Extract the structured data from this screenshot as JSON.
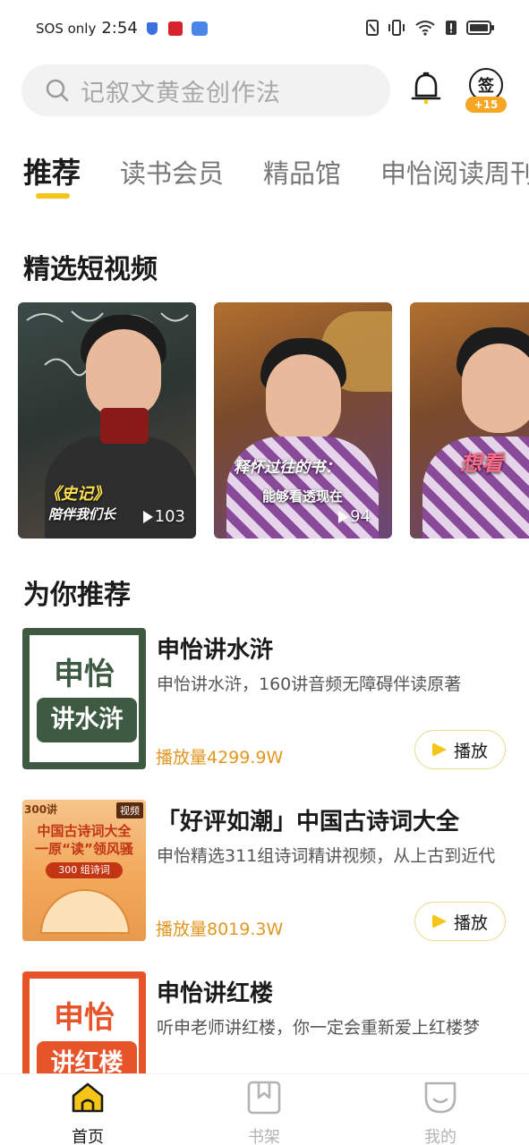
{
  "status_bar": {
    "carrier": "SOS only",
    "time": "2:54",
    "signal_label": "6"
  },
  "search": {
    "placeholder": "记叙文黄金创作法"
  },
  "header": {
    "checkin_label": "签",
    "checkin_badge": "+15"
  },
  "tabs": [
    {
      "label": "推荐",
      "active": true
    },
    {
      "label": "读书会员",
      "active": false
    },
    {
      "label": "精品馆",
      "active": false
    },
    {
      "label": "申怡阅读周刊",
      "active": false
    }
  ],
  "short_videos": {
    "title": "精选短视频",
    "items": [
      {
        "overlay_line1": "《史记》",
        "overlay_line2": "陪伴我们长",
        "plays": "103"
      },
      {
        "overlay_line1": "释怀过往的书：",
        "overlay_line2": "能够看透现在",
        "plays": "94"
      },
      {
        "overlay_line1": "想看",
        "overlay_line2": "",
        "plays": ""
      }
    ]
  },
  "recommend": {
    "title": "为你推荐",
    "items": [
      {
        "title": "申怡讲水浒",
        "desc": "申怡讲水浒，160讲音频无障碍伴读原著",
        "plays": "播放量4299.9W",
        "button": "播放",
        "cover_top": "申怡",
        "cover_bottom": "讲水浒"
      },
      {
        "title": "「好评如潮」中国古诗词大全",
        "desc": "申怡精选311组诗词精讲视频，从上古到近代",
        "plays": "播放量8019.3W",
        "button": "播放",
        "cover_badge": "300讲",
        "cover_tag": "视频",
        "cover_line1": "中国古诗词大全",
        "cover_line2": "一原“读”领风骚",
        "cover_line3": "300 组诗词"
      },
      {
        "title": "申怡讲红楼",
        "desc": "听申老师讲红楼，你一定会重新爱上红楼梦",
        "plays": "",
        "button": "",
        "cover_top": "申怡",
        "cover_bottom": "讲红楼"
      }
    ]
  },
  "bottom_nav": [
    {
      "label": "首页",
      "icon": "home-icon",
      "active": true
    },
    {
      "label": "书架",
      "icon": "bookshelf-icon",
      "active": false
    },
    {
      "label": "我的",
      "icon": "profile-icon",
      "active": false
    }
  ],
  "colors": {
    "accent_yellow": "#f5c518",
    "play_count_orange": "#e3961f",
    "shuihu_green": "#3e5a42",
    "honglou_red": "#e8542a"
  }
}
